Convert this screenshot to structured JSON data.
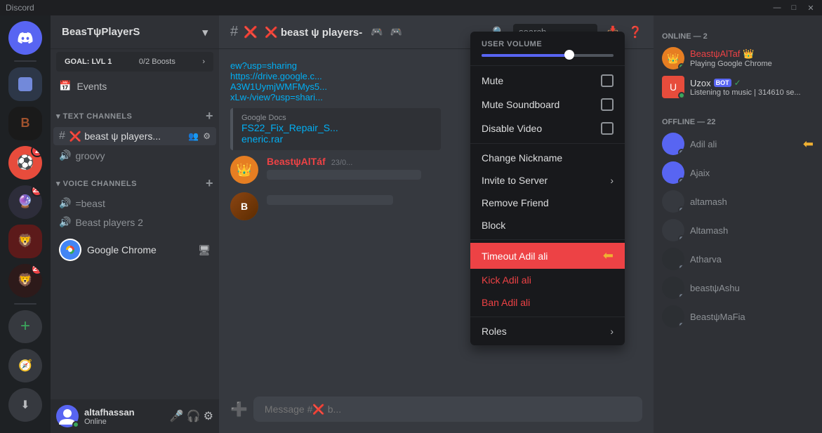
{
  "titlebar": {
    "title": "Discord",
    "minimize": "—",
    "maximize": "□",
    "close": "✕"
  },
  "server_icons": [
    {
      "id": "discord-home",
      "label": "Discord Home",
      "color": "#5865f2"
    },
    {
      "id": "server-1",
      "label": "Server 1",
      "color": "#36393f"
    },
    {
      "id": "server-beast",
      "label": "Beast Server",
      "color": "#2d2d2d"
    },
    {
      "id": "server-ball",
      "label": "Ball Server",
      "color": "#e74c3c",
      "badge": "2"
    },
    {
      "id": "server-purple",
      "label": "Purple Server",
      "color": "#7289da",
      "badge": "22"
    },
    {
      "id": "server-beast2",
      "label": "Beast 2",
      "color": "#8B1A1A"
    },
    {
      "id": "server-lion",
      "label": "Lion Server",
      "color": "#c0392b",
      "badge": "20"
    },
    {
      "id": "add-server",
      "label": "Add Server"
    }
  ],
  "channel_sidebar": {
    "server_name": "BeasTψPlayerS",
    "boost_goal_label": "GOAL: LVL 1",
    "boost_progress": "0/2 Boosts",
    "events_label": "Events",
    "text_channels_label": "TEXT CHANNELS",
    "voice_channels_label": "VOICE CHANNELS",
    "text_channels": [
      {
        "name": "❌ beast ψ players...",
        "active": true,
        "type": "text"
      },
      {
        "name": "groovy",
        "type": "text"
      }
    ],
    "voice_channels": [
      {
        "name": "=beast",
        "type": "voice"
      },
      {
        "name": "Beast players 2",
        "type": "voice"
      }
    ]
  },
  "chat_header": {
    "channel_icon": "#",
    "channel_name": "❌ beast ψ players-",
    "game_icon": "🎮"
  },
  "chat_messages": [
    {
      "author": "BeastψAlTáf",
      "timestamp": "23/0...",
      "content_link": "https://drive.google.c... A3W1UymjWMFMys5... xLw-/view?usp=shari...",
      "attachment": "FS22_Fix_Repair_S... eneric.rar",
      "attachment_source": "Google Docs"
    }
  ],
  "message_input_placeholder": "Message #❌ b...",
  "context_menu": {
    "volume_label": "User Volume",
    "volume_value": 65,
    "items": [
      {
        "label": "Mute",
        "has_checkbox": true,
        "id": "mute"
      },
      {
        "label": "Mute Soundboard",
        "has_checkbox": true,
        "id": "mute-soundboard"
      },
      {
        "label": "Disable Video",
        "has_checkbox": true,
        "id": "disable-video"
      },
      {
        "label": "Change Nickname",
        "id": "change-nickname"
      },
      {
        "label": "Invite to Server",
        "has_arrow": true,
        "id": "invite-to-server"
      },
      {
        "label": "Remove Friend",
        "id": "remove-friend"
      },
      {
        "label": "Block",
        "id": "block"
      },
      {
        "label": "Timeout Adil ali",
        "id": "timeout",
        "highlighted": true
      },
      {
        "label": "Kick Adil ali",
        "id": "kick",
        "danger": true
      },
      {
        "label": "Ban Adil ali",
        "id": "ban",
        "danger": true
      },
      {
        "label": "Roles",
        "has_arrow": true,
        "id": "roles"
      }
    ]
  },
  "right_sidebar": {
    "online_section": "ONLINE — 2",
    "online_members": [
      {
        "name": "BeastψAlTaf 👑",
        "activity": "Playing Google Chrome",
        "status": "online",
        "color": "#ed4245"
      },
      {
        "name": "Uzox",
        "bot": true,
        "activity": "Listening to music | 314610 se...",
        "status": "online"
      }
    ],
    "offline_section": "OFFLINE — 22",
    "offline_members": [
      {
        "name": "Adil ali",
        "status": "offline"
      },
      {
        "name": "Ajaix",
        "status": "offline"
      },
      {
        "name": "altamash",
        "status": "offline"
      },
      {
        "name": "Altamash",
        "status": "offline"
      },
      {
        "name": "Atharva",
        "status": "offline"
      },
      {
        "name": "beastψAshu",
        "status": "offline"
      },
      {
        "name": "BeastψMaFia",
        "status": "offline"
      }
    ]
  },
  "user_area": {
    "username": "altafhassan",
    "status": "Online"
  },
  "google_chrome_app": {
    "name": "Google Chrome",
    "screen_share": true
  }
}
